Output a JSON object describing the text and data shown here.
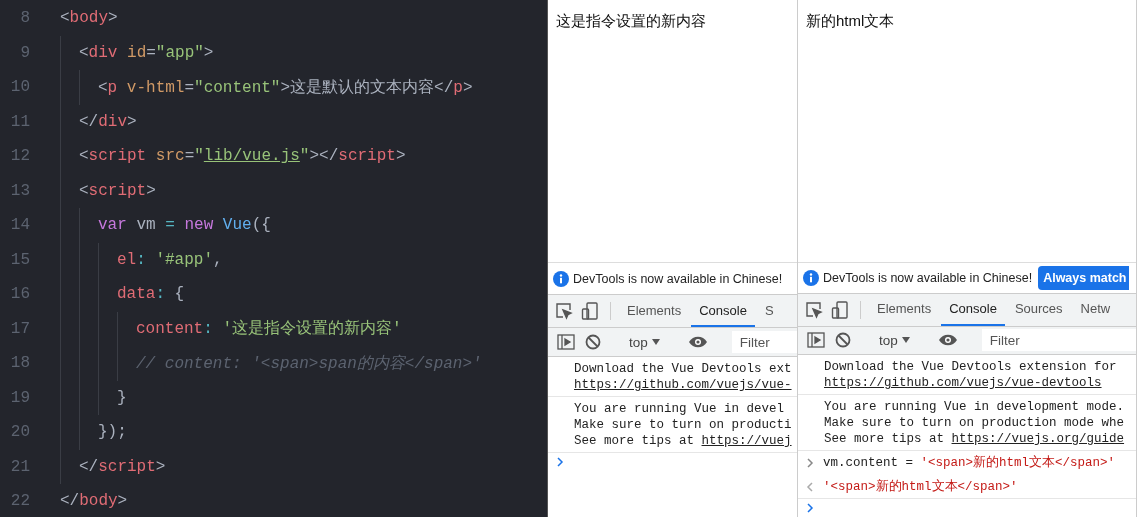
{
  "editor": {
    "lines": [
      {
        "number": "8",
        "tokens": [
          {
            "kind": "punct",
            "text": "<"
          },
          {
            "kind": "tag",
            "text": "body"
          },
          {
            "kind": "punct",
            "text": ">"
          }
        ],
        "children": [
          {
            "number": "9",
            "tokens": [
              {
                "kind": "punct",
                "text": "<"
              },
              {
                "kind": "tag",
                "text": "div"
              },
              {
                "kind": "attr",
                "text": " id"
              },
              {
                "kind": "punct",
                "text": "="
              },
              {
                "kind": "string",
                "text": "\"app\""
              },
              {
                "kind": "punct",
                "text": ">"
              }
            ],
            "children": [
              {
                "number": "10",
                "tokens": [
                  {
                    "kind": "punct",
                    "text": "<"
                  },
                  {
                    "kind": "tag",
                    "text": "p"
                  },
                  {
                    "kind": "attr",
                    "text": " v-html"
                  },
                  {
                    "kind": "punct",
                    "text": "="
                  },
                  {
                    "kind": "string",
                    "text": "\"content\""
                  },
                  {
                    "kind": "punct",
                    "text": ">这是默认的文本内容</"
                  },
                  {
                    "kind": "tag",
                    "text": "p"
                  },
                  {
                    "kind": "punct",
                    "text": ">"
                  }
                ]
              }
            ]
          },
          {
            "number": "11",
            "tokens": [
              {
                "kind": "punct",
                "text": "</"
              },
              {
                "kind": "tag",
                "text": "div"
              },
              {
                "kind": "punct",
                "text": ">"
              }
            ]
          },
          {
            "number": "12",
            "tokens": [
              {
                "kind": "punct",
                "text": "<"
              },
              {
                "kind": "tag",
                "text": "script"
              },
              {
                "kind": "attr",
                "text": " src"
              },
              {
                "kind": "punct",
                "text": "="
              },
              {
                "kind": "string",
                "text": "\""
              },
              {
                "kind": "link",
                "text": "lib/vue.js"
              },
              {
                "kind": "string",
                "text": "\""
              },
              {
                "kind": "punct",
                "text": "></"
              },
              {
                "kind": "tag",
                "text": "script"
              },
              {
                "kind": "punct",
                "text": ">"
              }
            ]
          },
          {
            "number": "13",
            "tokens": [
              {
                "kind": "punct",
                "text": "<"
              },
              {
                "kind": "tag",
                "text": "script"
              },
              {
                "kind": "punct",
                "text": ">"
              }
            ],
            "children": [
              {
                "number": "14",
                "tokens": [
                  {
                    "kind": "keyword",
                    "text": "var"
                  },
                  {
                    "kind": "plain",
                    "text": " vm "
                  },
                  {
                    "kind": "op",
                    "text": "="
                  },
                  {
                    "kind": "keyword",
                    "text": " new"
                  },
                  {
                    "kind": "func",
                    "text": " Vue"
                  },
                  {
                    "kind": "plain",
                    "text": "({"
                  }
                ],
                "children": [
                  {
                    "number": "15",
                    "tokens": [
                      {
                        "kind": "prop",
                        "text": "el"
                      },
                      {
                        "kind": "op",
                        "text": ":"
                      },
                      {
                        "kind": "string",
                        "text": " '#app'"
                      },
                      {
                        "kind": "plain",
                        "text": ","
                      }
                    ]
                  },
                  {
                    "number": "16",
                    "tokens": [
                      {
                        "kind": "prop",
                        "text": "data"
                      },
                      {
                        "kind": "op",
                        "text": ":"
                      },
                      {
                        "kind": "plain",
                        "text": " {"
                      }
                    ],
                    "children": [
                      {
                        "number": "17",
                        "tokens": [
                          {
                            "kind": "prop",
                            "text": "content"
                          },
                          {
                            "kind": "op",
                            "text": ":"
                          },
                          {
                            "kind": "string",
                            "text": " '这是指令设置的新内容'"
                          }
                        ]
                      },
                      {
                        "number": "18",
                        "tokens": [
                          {
                            "kind": "comment",
                            "text": "// content: '<span>span的内容</span>'"
                          }
                        ]
                      }
                    ]
                  },
                  {
                    "number": "19",
                    "tokens": [
                      {
                        "kind": "plain",
                        "text": "}"
                      }
                    ]
                  }
                ]
              },
              {
                "number": "20",
                "tokens": [
                  {
                    "kind": "plain",
                    "text": "});"
                  }
                ]
              }
            ]
          },
          {
            "number": "21",
            "tokens": [
              {
                "kind": "punct",
                "text": "</"
              },
              {
                "kind": "tag",
                "text": "script"
              },
              {
                "kind": "punct",
                "text": ">"
              }
            ]
          }
        ]
      },
      {
        "number": "22",
        "tokens": [
          {
            "kind": "punct",
            "text": "</"
          },
          {
            "kind": "tag",
            "text": "body"
          },
          {
            "kind": "punct",
            "text": ">"
          }
        ]
      }
    ]
  },
  "browsers": [
    {
      "page_text": "这是指令设置的新内容",
      "devtools": {
        "banner": {
          "message": "DevTools is now available in Chinese!"
        },
        "tabs": [
          {
            "label": "Elements",
            "selected": false
          },
          {
            "label": "Console",
            "selected": true
          },
          {
            "label": "S",
            "selected": false
          }
        ],
        "toolbar": {
          "context": "top",
          "filter_placeholder": "Filter"
        },
        "console": [
          {
            "kind": "log",
            "lines": [
              {
                "text": "Download the Vue Devtools ext"
              },
              {
                "link": "https://github.com/vuejs/vue-"
              }
            ]
          },
          {
            "kind": "log",
            "lines": [
              {
                "text": "You are running Vue in devel"
              },
              {
                "text": "Make sure to turn on producti"
              },
              {
                "text": "See more tips at ",
                "link": "https://vuej"
              }
            ]
          },
          {
            "kind": "prompt"
          }
        ]
      }
    },
    {
      "page_text": "新的html文本",
      "devtools": {
        "banner": {
          "message": "DevTools is now available in Chinese!",
          "button": "Always match"
        },
        "tabs": [
          {
            "label": "Elements",
            "selected": false
          },
          {
            "label": "Console",
            "selected": true
          },
          {
            "label": "Sources",
            "selected": false
          },
          {
            "label": "Netw",
            "selected": false
          }
        ],
        "toolbar": {
          "context": "top",
          "filter_placeholder": "Filter"
        },
        "console": [
          {
            "kind": "log",
            "lines": [
              {
                "text": "Download the Vue Devtools extension for"
              },
              {
                "link": "https://github.com/vuejs/vue-devtools"
              }
            ]
          },
          {
            "kind": "log",
            "lines": [
              {
                "text": "You are running Vue in development mode."
              },
              {
                "text": "Make sure to turn on production mode whe"
              },
              {
                "text": "See more tips at ",
                "link": "https://vuejs.org/guide"
              }
            ]
          },
          {
            "kind": "input",
            "text": "vm.content = '<span>新的html文本</span>'"
          },
          {
            "kind": "result",
            "text": "'<span>新的html文本</span>'"
          },
          {
            "kind": "prompt"
          }
        ]
      }
    }
  ]
}
